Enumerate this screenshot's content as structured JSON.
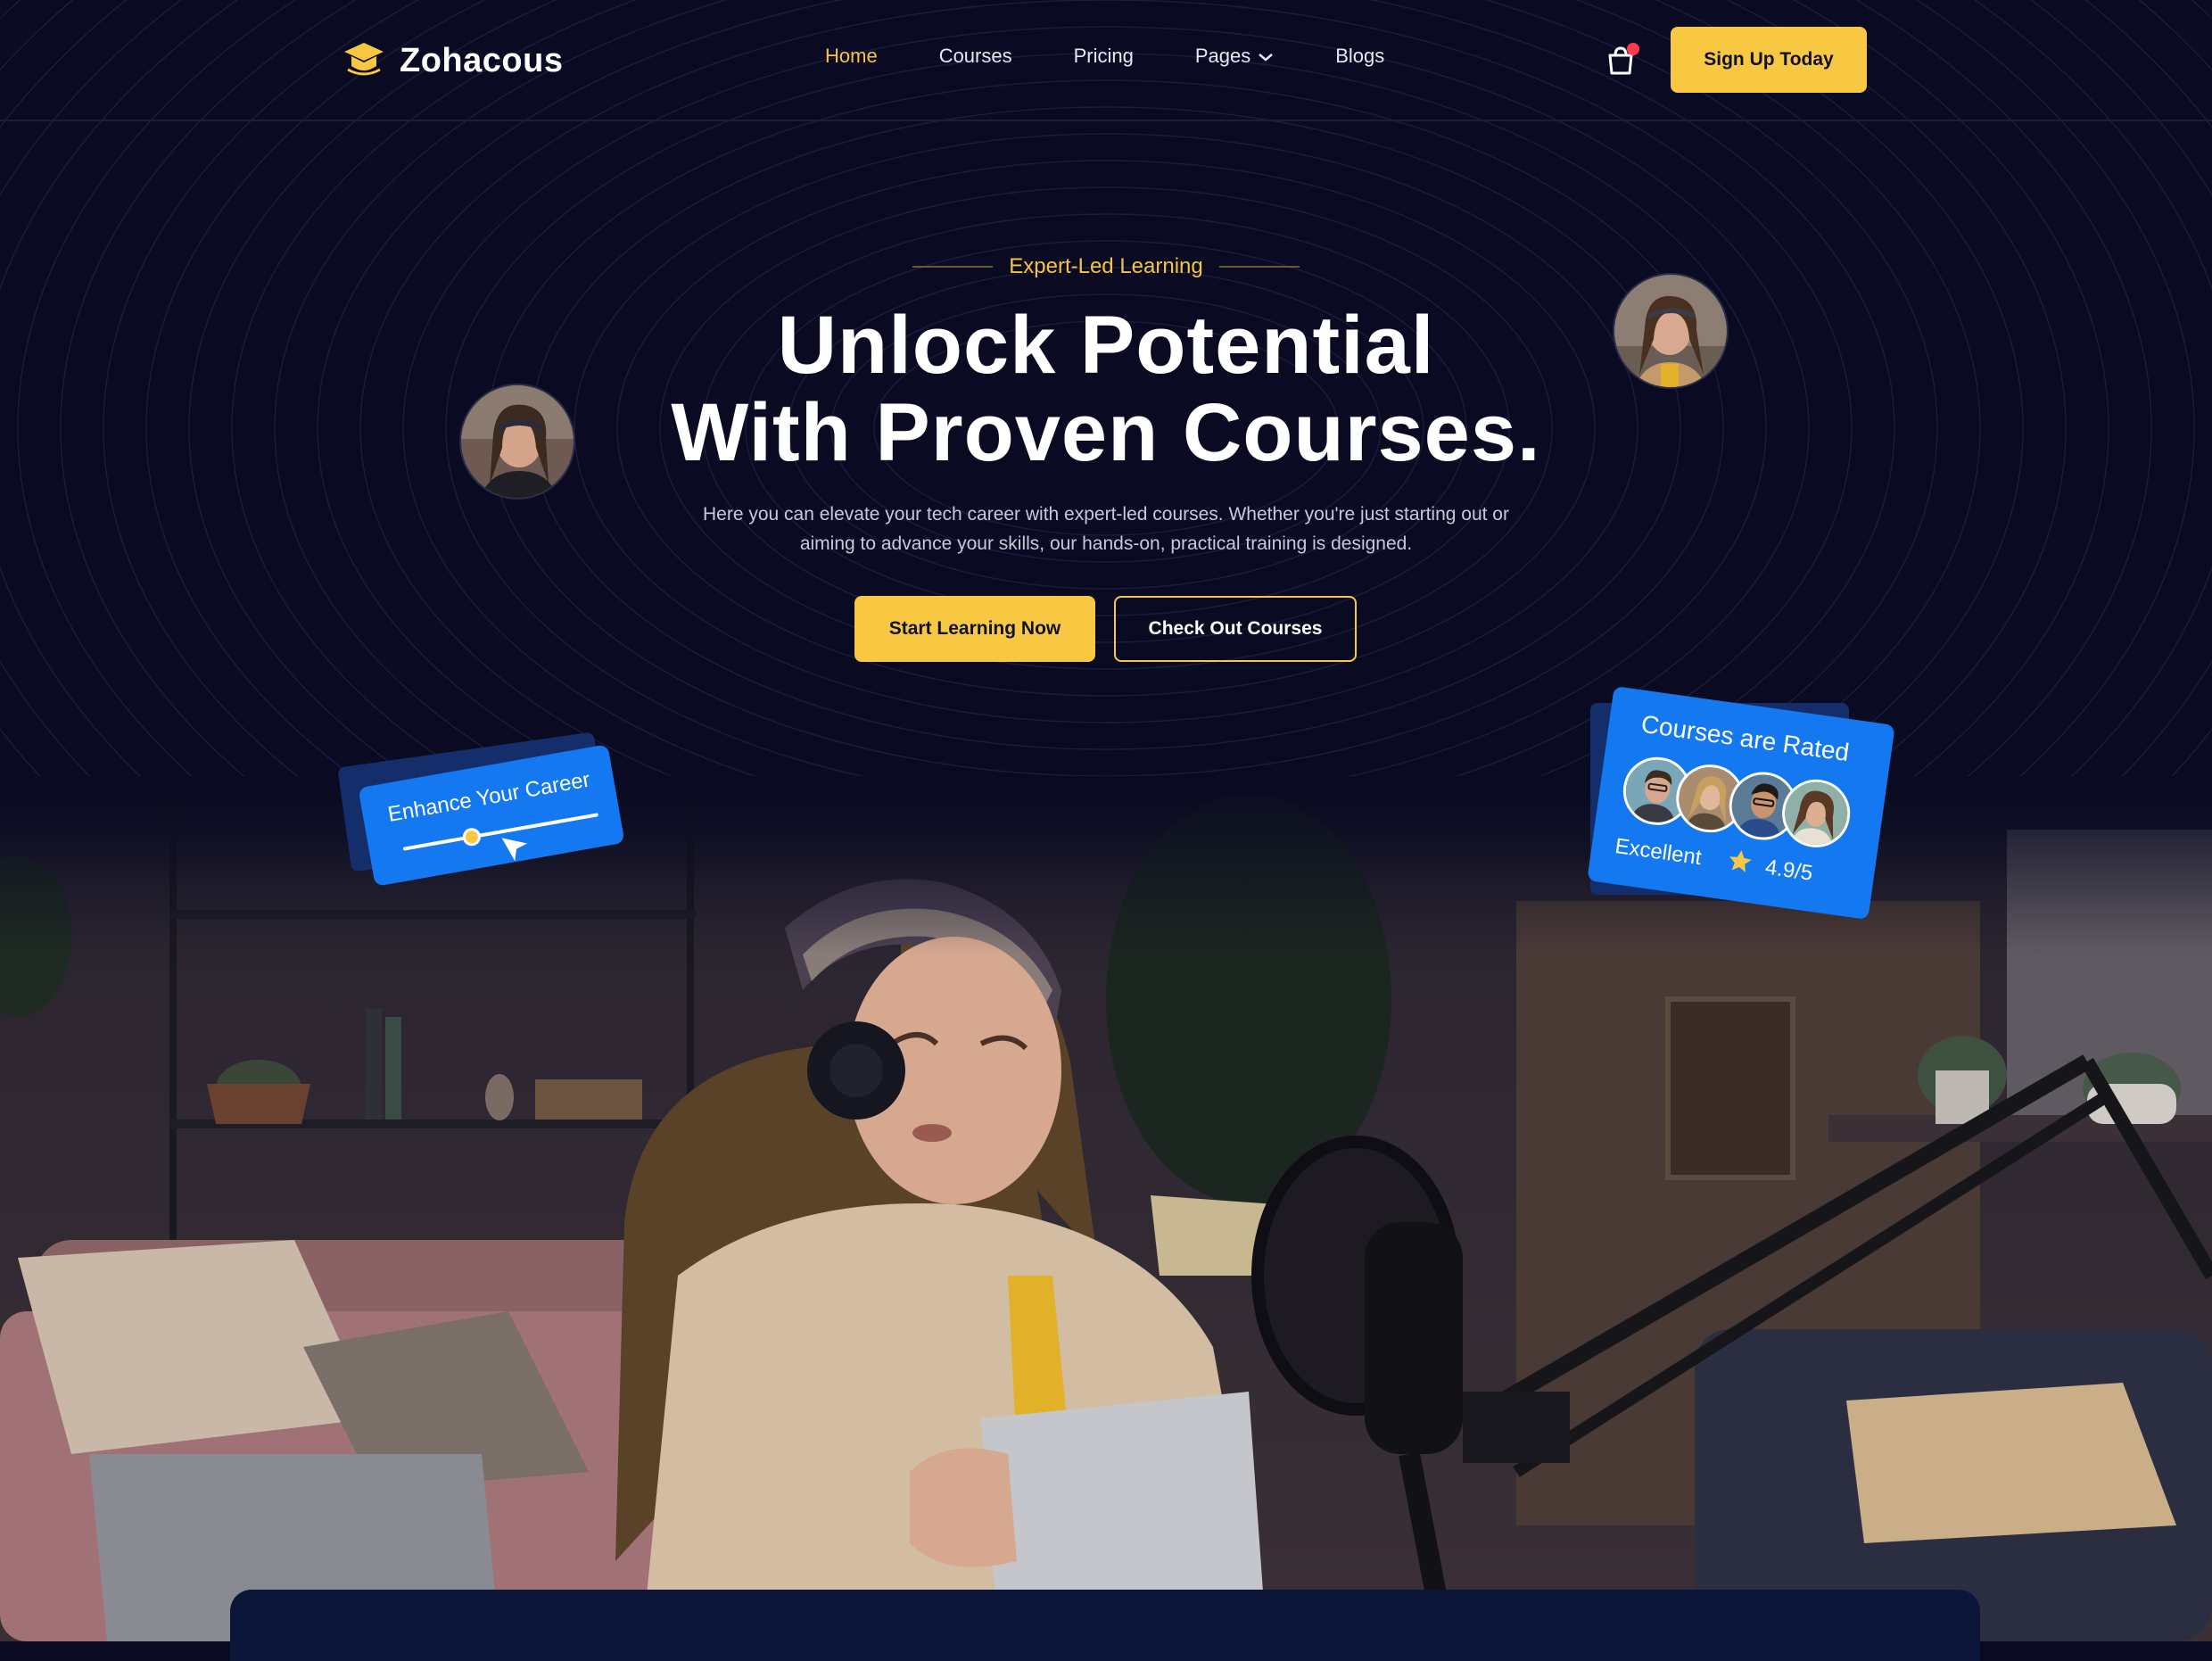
{
  "brand": {
    "name": "Zohacous",
    "logo_icon": "graduation-cap-icon"
  },
  "nav": {
    "items": [
      {
        "label": "Home",
        "active": true
      },
      {
        "label": "Courses",
        "active": false
      },
      {
        "label": "Pricing",
        "active": false
      },
      {
        "label": "Pages",
        "active": false,
        "has_dropdown": true
      },
      {
        "label": "Blogs",
        "active": false
      }
    ],
    "cart_icon": "shopping-bag-icon",
    "signup_label": "Sign Up Today"
  },
  "hero": {
    "tagline": "Expert-Led Learning",
    "title_line1": "Unlock Potential",
    "title_line2": "With Proven Courses.",
    "description": "Here you can elevate your tech career with expert-led courses. Whether you're just starting out or aiming to advance your skills, our hands-on, practical training is designed.",
    "primary_cta": "Start Learning Now",
    "secondary_cta": "Check Out Courses"
  },
  "cards": {
    "enhance": {
      "title": "Enhance Your Career",
      "slider_level": 0.35
    },
    "rated": {
      "title": "Courses are Rated",
      "label": "Excellent",
      "score": "4.9/5"
    }
  },
  "colors": {
    "background": "#0a0b22",
    "accent": "#f9c843",
    "card_blue": "#1478f0",
    "notification": "#ff3b4e"
  }
}
